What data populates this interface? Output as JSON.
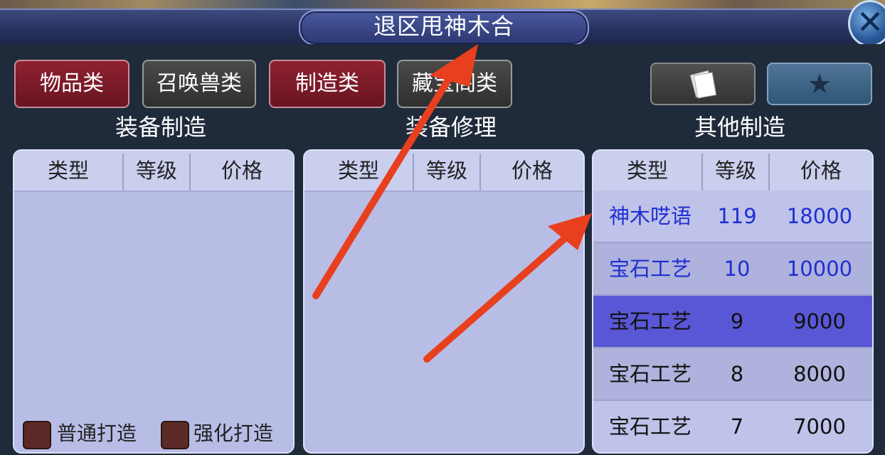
{
  "window": {
    "title": "退区甩神木合",
    "close_label": "✕"
  },
  "tabs": [
    {
      "label": "物品类",
      "active": true
    },
    {
      "label": "召唤兽类",
      "active": false
    },
    {
      "label": "制造类",
      "active": true
    },
    {
      "label": "藏宝阁类",
      "active": false
    }
  ],
  "toolbar": {
    "book_icon": "book-icon",
    "star_icon": "star-icon",
    "star_glyph": "★"
  },
  "columns": {
    "type": "类型",
    "level": "等级",
    "price": "价格"
  },
  "equipment_make": {
    "title": "装备制造",
    "rows": []
  },
  "equipment_repair": {
    "title": "装备修理",
    "rows": []
  },
  "other_make": {
    "title": "其他制造",
    "rows": [
      {
        "type": "神木呓语",
        "level": "119",
        "price": "18000",
        "style": "blue"
      },
      {
        "type": "宝石工艺",
        "level": "10",
        "price": "10000",
        "style": "blue"
      },
      {
        "type": "宝石工艺",
        "level": "9",
        "price": "9000",
        "style": "selected"
      },
      {
        "type": "宝石工艺",
        "level": "8",
        "price": "8000",
        "style": "normal"
      },
      {
        "type": "宝石工艺",
        "level": "7",
        "price": "7000",
        "style": "normal"
      }
    ]
  },
  "options": {
    "normal_forge": "普通打造",
    "enhanced_forge": "强化打造"
  },
  "colors": {
    "annotation_arrow": "#e8401f",
    "selected_row": "#5a57d6",
    "blue_text": "#1f2fd0"
  }
}
